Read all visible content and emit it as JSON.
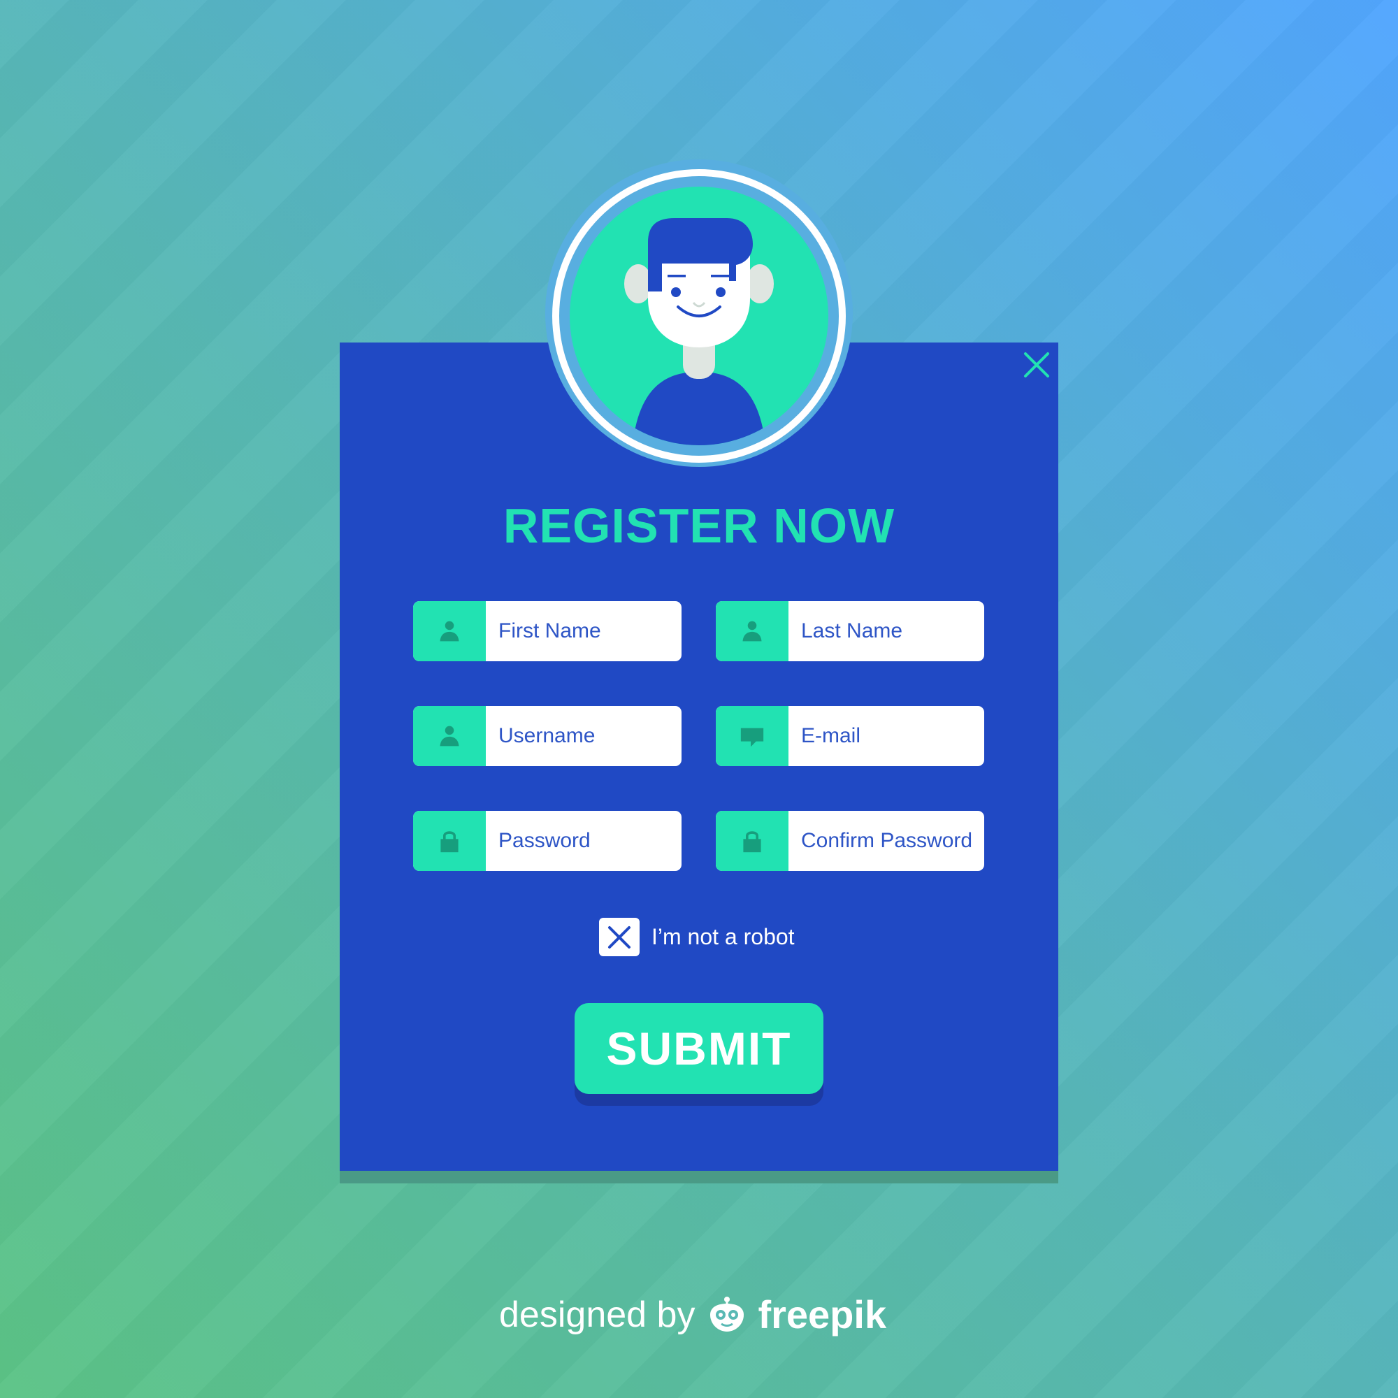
{
  "colors": {
    "card": "#2049c4",
    "accent": "#22e2b2",
    "field_bg": "#ffffff",
    "field_text": "#2e55c6",
    "icon_dark": "#179e7d"
  },
  "form": {
    "title": "REGISTER NOW",
    "close_icon": "close-icon",
    "fields": [
      {
        "placeholder": "First Name",
        "value": "",
        "icon": "user-icon"
      },
      {
        "placeholder": "Last Name",
        "value": "",
        "icon": "user-icon"
      },
      {
        "placeholder": "Username",
        "value": "",
        "icon": "user-icon"
      },
      {
        "placeholder": "E-mail",
        "value": "",
        "icon": "speech-bubble-icon"
      },
      {
        "placeholder": "Password",
        "value": "",
        "icon": "lock-icon"
      },
      {
        "placeholder": "Confirm Password",
        "value": "",
        "icon": "lock-icon"
      }
    ],
    "captcha_label": "I’m not a robot",
    "captcha_checked": true,
    "submit_label": "SUBMIT"
  },
  "footer": {
    "prefix": "designed by",
    "brand": "freepik"
  }
}
